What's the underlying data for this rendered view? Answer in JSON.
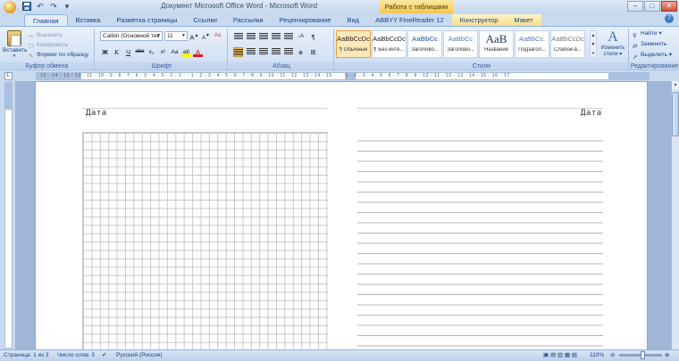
{
  "window": {
    "title": "Документ Microsoft Office Word - Microsoft Word",
    "context_tab_title": "Работа с таблицами",
    "buttons": {
      "minimize": "–",
      "maximize": "□",
      "close": "✕"
    }
  },
  "quick_access": {
    "undo": "↶",
    "redo": "↷",
    "more": "▾"
  },
  "tabs": [
    {
      "label": "Главная",
      "active": true
    },
    {
      "label": "Вставка"
    },
    {
      "label": "Разметка страницы"
    },
    {
      "label": "Ссылки"
    },
    {
      "label": "Рассылки"
    },
    {
      "label": "Рецензирование"
    },
    {
      "label": "Вид"
    },
    {
      "label": "ABBYY FineReader 12"
    },
    {
      "label": "Конструктор",
      "context": true
    },
    {
      "label": "Макет",
      "context": true
    }
  ],
  "help": "?",
  "clipboard": {
    "group_label": "Буфер обмена",
    "paste_label": "Вставить",
    "cut": "Вырезать",
    "copy": "Копировать",
    "format_painter": "Формат по образцу"
  },
  "font": {
    "group_label": "Шрифт",
    "font_name": "Calibri (Основной тек",
    "font_size": "11",
    "grow": "A",
    "shrink": "A",
    "clear": "Aa",
    "bold": "Ж",
    "italic": "К",
    "underline": "Ч",
    "strike": "abe",
    "subscript": "x₂",
    "superscript": "x²",
    "case": "Aa",
    "highlight": "ab",
    "color": "A"
  },
  "paragraph": {
    "group_label": "Абзац",
    "pilcrow": "¶",
    "sort": "↓A"
  },
  "styles": {
    "group_label": "Стили",
    "items": [
      {
        "sample": "AaBbCcDc",
        "name": "¶ Обычный",
        "selected": true
      },
      {
        "sample": "AaBbCcDc",
        "name": "¶ Без инте..."
      },
      {
        "sample": "AaBbCc",
        "name": "Заголово...",
        "kind": "blue"
      },
      {
        "sample": "AaBbCc",
        "name": "Заголово...",
        "kind": "blue"
      },
      {
        "sample": "AaB",
        "name": "Название",
        "kind": "big"
      },
      {
        "sample": "AaBbCc.",
        "name": "Подзагол...",
        "kind": "sub"
      },
      {
        "sample": "AaBbCcDc",
        "name": "Слабое в...",
        "kind": "em"
      }
    ],
    "change_styles_icon": "A",
    "change_styles_label": "Изменить стили ▾"
  },
  "editing": {
    "group_label": "Редактирование",
    "find": "Найти ▾",
    "replace": "Заменить",
    "select": "Выделить ▾"
  },
  "ruler": {
    "corner": "L",
    "numbers": "· 15 · 14 · 13 · 12 · 11 · 10 · 9 · 8 · 7 · 6 · 5 · 4 · 3 · 2 · 1 · · 1 · 2 · 3 · 4 · 5 · 6 · 7 · 8 · 9 · 10 · 11 · 12 · 13 · 14 · 15 · · · 1 · 2 · 3 · 4 · 5 · 6 · 7 · 8 · 9 · 10 · 11 · 12 · 13 · 14 · 15 · 16 · 17 ·"
  },
  "document": {
    "left_date": "Дата",
    "right_date": "Дата"
  },
  "scrollbar": {
    "up": "▲"
  },
  "status": {
    "page": "Страница: 1 из 3",
    "words": "Число слов: 3",
    "language": "Русский (Россия)",
    "zoom": "110%",
    "zoom_level": 0.55
  }
}
